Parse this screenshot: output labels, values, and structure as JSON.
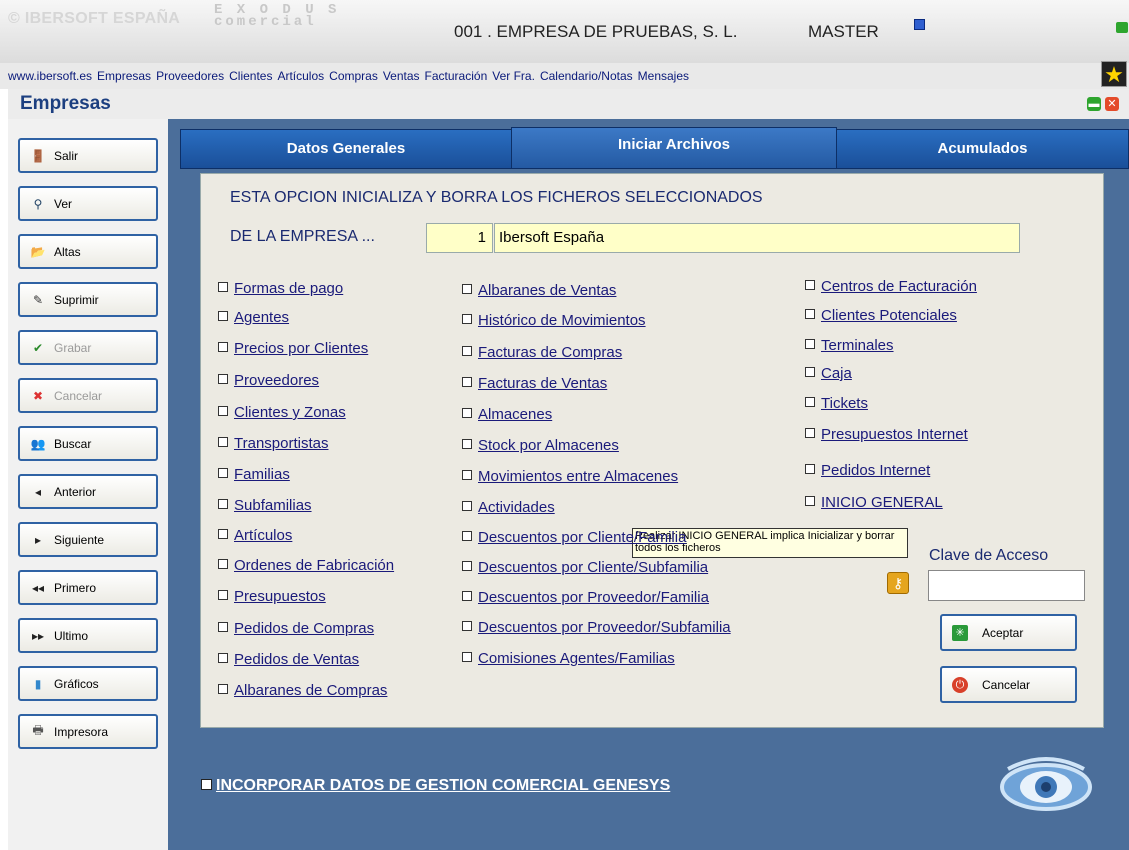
{
  "header": {
    "brand": "© IBERSOFT ESPAÑA",
    "exodus_top": "E X O D U S",
    "exodus_bottom": "comercial",
    "company": "001 . EMPRESA DE PRUEBAS, S. L.",
    "user": "MASTER"
  },
  "menu": [
    "www.ibersoft.es",
    "Empresas",
    "Proveedores",
    "Clientes",
    "Artículos",
    "Compras",
    "Ventas",
    "Facturación",
    "Ver Fra.",
    "Calendario/Notas",
    "Mensajes"
  ],
  "window": {
    "title": "Empresas"
  },
  "sidebar": [
    {
      "label": "Salir",
      "icon": "exit-icon",
      "enabled": true
    },
    {
      "label": "Ver",
      "icon": "magnifier-icon",
      "enabled": true
    },
    {
      "label": "Altas",
      "icon": "folder-open-icon",
      "enabled": true
    },
    {
      "label": "Suprimir",
      "icon": "pencil-erase-icon",
      "enabled": true
    },
    {
      "label": "Grabar",
      "icon": "checkmark-icon",
      "enabled": false
    },
    {
      "label": "Cancelar",
      "icon": "cancel-x-icon",
      "enabled": false
    },
    {
      "label": "Buscar",
      "icon": "users-search-icon",
      "enabled": true
    },
    {
      "label": "Anterior",
      "icon": "triangle-left-icon",
      "enabled": true
    },
    {
      "label": "Siguiente",
      "icon": "triangle-right-icon",
      "enabled": true
    },
    {
      "label": "Primero",
      "icon": "double-left-icon",
      "enabled": true
    },
    {
      "label": "Ultimo",
      "icon": "double-right-icon",
      "enabled": true
    },
    {
      "label": "Gráficos",
      "icon": "bar-chart-icon",
      "enabled": true
    },
    {
      "label": "Impresora",
      "icon": "printer-icon",
      "enabled": true
    }
  ],
  "tabs": [
    {
      "label": "Datos Generales",
      "active": false
    },
    {
      "label": "Iniciar Archivos",
      "active": true
    },
    {
      "label": "Acumulados",
      "active": false
    }
  ],
  "panel": {
    "heading": "ESTA OPCION INICIALIZA Y BORRA LOS FICHEROS SELECCIONADOS",
    "empresa_label": "DE LA EMPRESA ...",
    "empresa_num": "1",
    "empresa_name": "Ibersoft España",
    "col1": [
      "Formas de pago",
      "Agentes",
      "Precios por Clientes",
      "Proveedores",
      "Clientes y Zonas",
      "Transportistas",
      "Familias",
      "Subfamilias",
      "Artículos",
      "Ordenes de Fabricación",
      "Presupuestos",
      "Pedidos de Compras",
      "Pedidos de Ventas",
      "Albaranes de Compras"
    ],
    "col2": [
      "Albaranes de Ventas",
      "Histórico de Movimientos",
      "Facturas de Compras",
      "Facturas de Ventas",
      "Almacenes",
      "Stock por Almacenes",
      "Movimientos entre Almacenes",
      "Actividades",
      "Descuentos por Cliente/Familia",
      "Descuentos por Cliente/Subfamilia",
      "Descuentos por Proveedor/Familia",
      "Descuentos por Proveedor/Subfamilia",
      "Comisiones Agentes/Familias"
    ],
    "col3": [
      "Centros de Facturación",
      "Clientes Potenciales",
      "Terminales",
      "Caja",
      "Tickets",
      "Presupuestos Internet",
      "Pedidos Internet",
      "INICIO GENERAL"
    ],
    "tooltip_line1": "Realizar INICIO GENERAL implica Inicializar y borrar",
    "tooltip_line2": "todos los ficheros",
    "clave_label": "Clave de Acceso",
    "clave_value": "",
    "aceptar": "Aceptar",
    "cancelar": "Cancelar"
  },
  "incorporar": "INCORPORAR DATOS DE GESTION COMERCIAL GENESYS",
  "colors": {
    "window_bg": "#4b6e9a",
    "tab_blue": "#1a4f99",
    "link_blue": "#1a1a7a",
    "input_yellow": "#ffffc8"
  }
}
